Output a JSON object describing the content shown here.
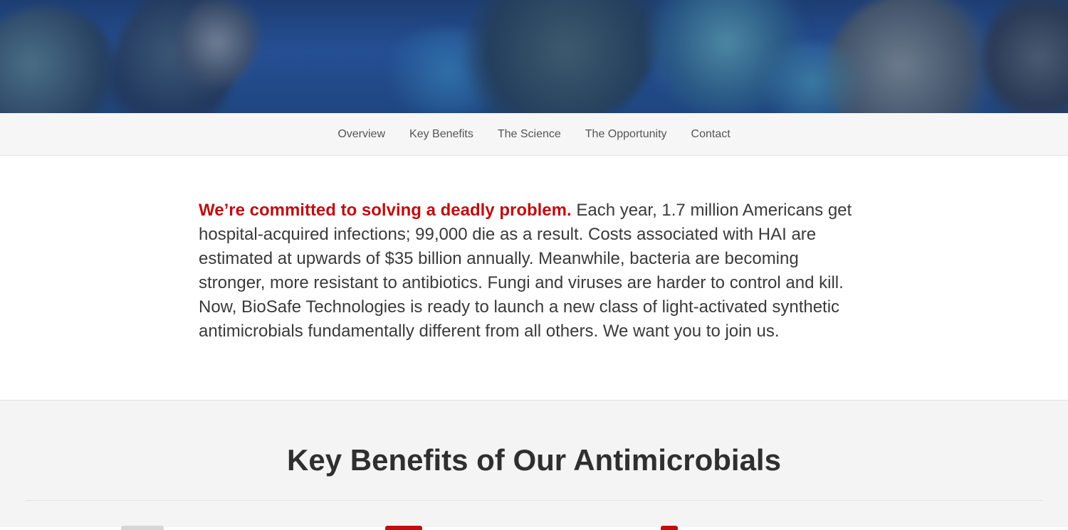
{
  "nav": {
    "items": [
      {
        "label": "Overview"
      },
      {
        "label": "Key Benefits"
      },
      {
        "label": "The Science"
      },
      {
        "label": "The Opportunity"
      },
      {
        "label": "Contact"
      }
    ]
  },
  "intro": {
    "lead": "We’re committed to solving a deadly problem.",
    "body": " Each year, 1.7 million Americans get hospital-acquired infections; 99,000 die as a result. Costs associated with HAI are estimated at upwards of $35 billion annually. Meanwhile, bacteria are becoming stronger, more resistant to antibiotics. Fungi and viruses are harder to control and kill. Now, BioSafe Technologies is ready to launch a new class of light-activated synthetic antimicrobials fundamentally different from all others. We want you to join us."
  },
  "benefits": {
    "title": "Key Benefits of Our Antimicrobials"
  },
  "colors": {
    "accent": "#c00d10",
    "nav_bg": "#f6f6f6",
    "section_bg": "#f4f4f4",
    "text": "#3a3a3a"
  }
}
